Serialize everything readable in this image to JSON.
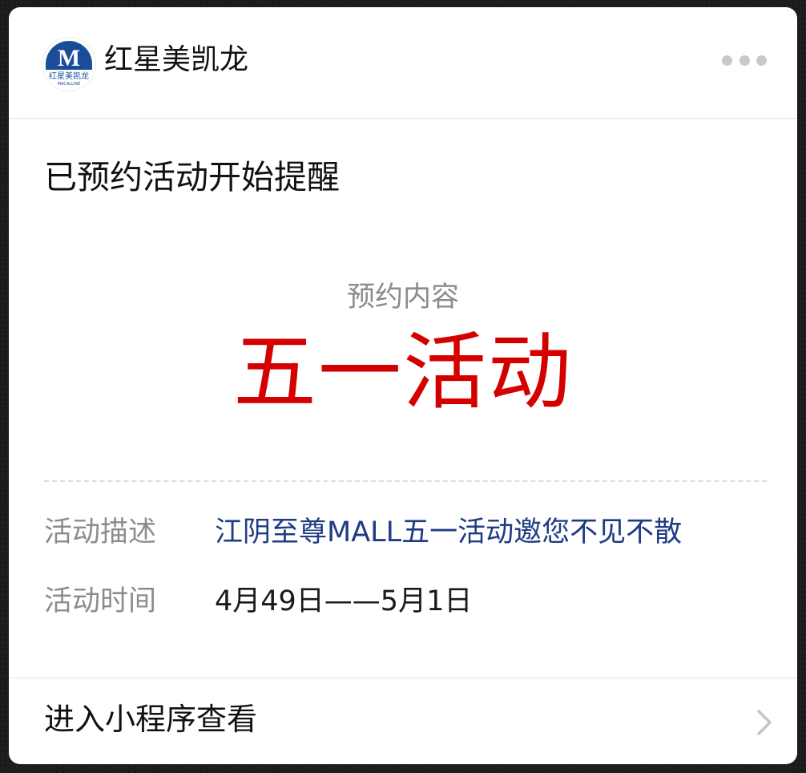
{
  "header": {
    "logo": {
      "icon": "macalline-logo",
      "letter": "M",
      "caption_cn": "红星美凯龙",
      "caption_en": "MACALLINE"
    },
    "brand_name": "红星美凯龙",
    "more_icon": "ellipsis-icon"
  },
  "notice": {
    "title": "已预约活动开始提醒",
    "content_label": "预约内容",
    "content_value": "五一活动"
  },
  "details": {
    "description_label": "活动描述",
    "description_value": "江阴至尊MALL五一活动邀您不见不散",
    "time_label": "活动时间",
    "time_value": "4月49日——5月1日"
  },
  "footer": {
    "link_text": "进入小程序查看",
    "chevron_icon": "chevron-right-icon"
  },
  "colors": {
    "accent_red": "#d40000",
    "link_blue": "#1f3b84",
    "logo_blue": "#1a4c9c",
    "muted_gray": "#8c8c8c"
  }
}
